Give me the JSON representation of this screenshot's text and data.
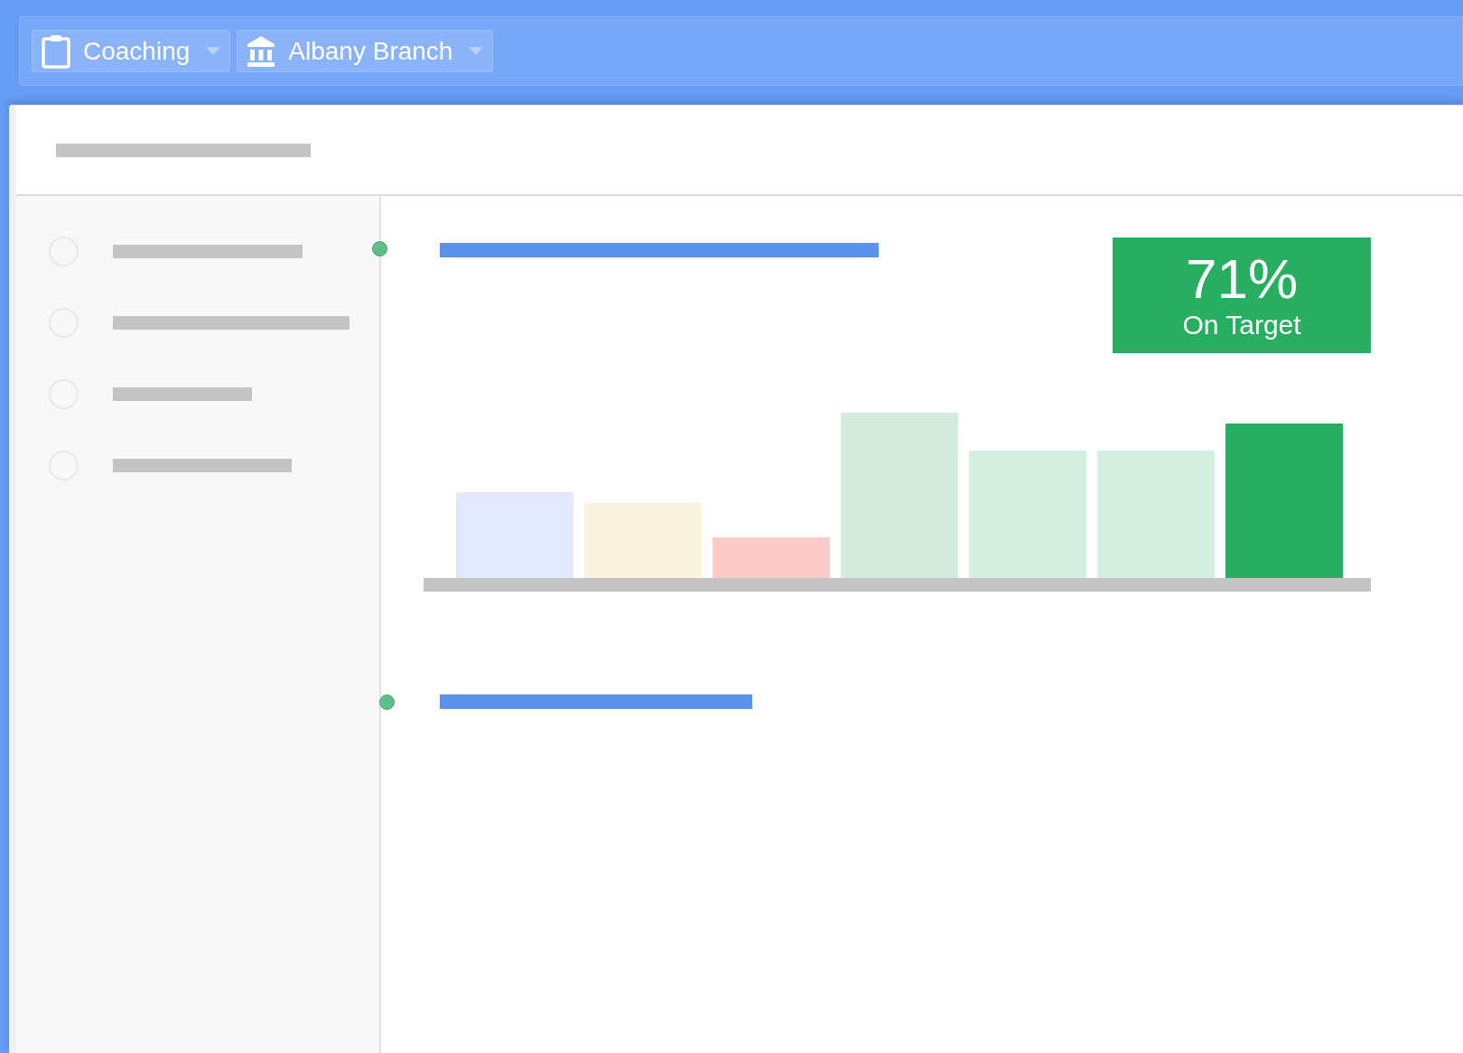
{
  "toolbar": {
    "dropdowns": [
      {
        "kind": "clipboard",
        "label": "Coaching"
      },
      {
        "kind": "bank",
        "label": "Albany Branch"
      }
    ]
  },
  "kpi": {
    "value": "71%",
    "label": "On Target"
  }
}
